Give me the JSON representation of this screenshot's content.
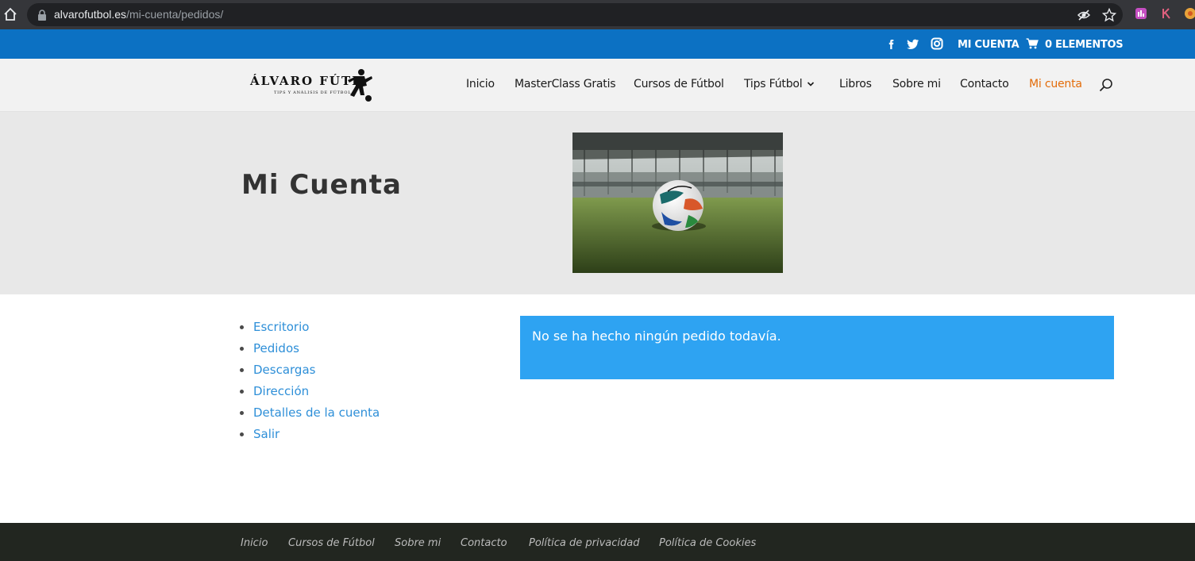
{
  "browser": {
    "url_domain": "alvarofutbol.es",
    "url_path": "/mi-cuenta/pedidos/",
    "icons": [
      "home-icon",
      "lock-icon",
      "eye-off-icon",
      "star-icon",
      "extension-icon",
      "k-extension-icon",
      "extension-icon"
    ]
  },
  "top_bar": {
    "social": [
      "facebook-icon",
      "twitter-icon",
      "instagram-icon"
    ],
    "account_label": "MI CUENTA",
    "cart_label": "0 ELEMENTOS",
    "background": "#0c71c3"
  },
  "logo": {
    "title": "ÁLVARO FÚTB",
    "subtitle": "TIPS Y ANÁLISIS DE FÚTBOL"
  },
  "nav": {
    "items": [
      {
        "label": "Inicio"
      },
      {
        "label": "MasterClass Gratis"
      },
      {
        "label": "Cursos de Fútbol"
      },
      {
        "label": "Tips Fútbol"
      },
      {
        "label": "Libros"
      },
      {
        "label": "Sobre mi"
      },
      {
        "label": "Contacto"
      },
      {
        "label": "Mi cuenta"
      }
    ],
    "active_color": "#e36c09"
  },
  "hero": {
    "title": "Mi Cuenta"
  },
  "account_nav": {
    "items": [
      {
        "label": "Escritorio"
      },
      {
        "label": "Pedidos"
      },
      {
        "label": "Descargas"
      },
      {
        "label": "Dirección"
      },
      {
        "label": "Detalles de la cuenta"
      },
      {
        "label": "Salir"
      }
    ],
    "link_color": "#2e8fd8"
  },
  "notice": {
    "text": "No se ha hecho ningún pedido todavía.",
    "background": "#2ea3f2"
  },
  "footer": {
    "links": [
      {
        "label": "Inicio"
      },
      {
        "label": "Cursos de Fútbol"
      },
      {
        "label": "Sobre mi"
      },
      {
        "label": "Contacto"
      },
      {
        "label": "Política de privacidad"
      },
      {
        "label": "Política de Cookies"
      }
    ],
    "background": "#222620"
  }
}
